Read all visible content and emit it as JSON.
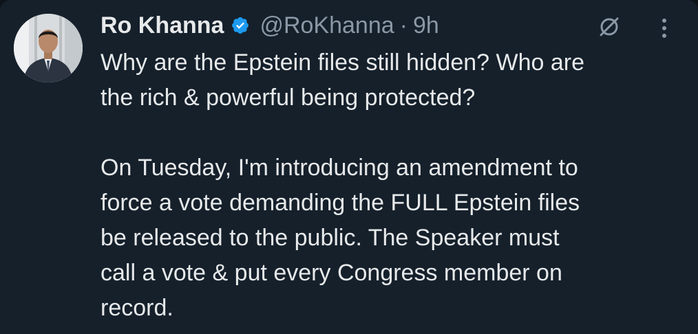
{
  "tweet": {
    "display_name": "Ro Khanna",
    "handle": "@RoKhanna",
    "separator": "·",
    "timestamp": "9h",
    "paragraphs": [
      "Why are the Epstein files still hidden? Who are\nthe rich & powerful being protected?",
      "On Tuesday, I'm introducing an amendment to\nforce a vote demanding the FULL Epstein files\nbe released to the public. The Speaker must\ncall a vote & put every Congress member on\nrecord."
    ]
  },
  "icons": {
    "verified": "verified-badge-icon",
    "grok": "grok-icon",
    "more": "more-vertical-icon"
  },
  "colors": {
    "background": "#15202b",
    "text": "#e7e9ea",
    "secondary_text": "#8b98a5",
    "verified_blue": "#1d9bf0"
  }
}
